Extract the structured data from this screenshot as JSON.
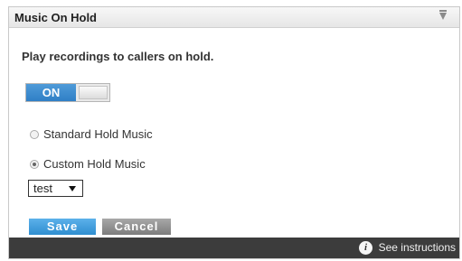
{
  "panel": {
    "title": "Music On Hold",
    "collapse_icon": "chevron-down-icon"
  },
  "description": "Play recordings to callers on hold.",
  "toggle": {
    "on_label": "ON",
    "state": "on",
    "accent_color": "#2f7fc6"
  },
  "options": {
    "standard_label": "Standard Hold Music",
    "custom_label": "Custom Hold Music",
    "selected": "custom"
  },
  "custom_select": {
    "value": "test"
  },
  "buttons": {
    "save_label": "Save",
    "cancel_label": "Cancel",
    "save_color": "#2f8ed0",
    "cancel_color": "#7d7d7d"
  },
  "footer": {
    "info_icon": "info-icon",
    "instructions_label": "See instructions"
  }
}
